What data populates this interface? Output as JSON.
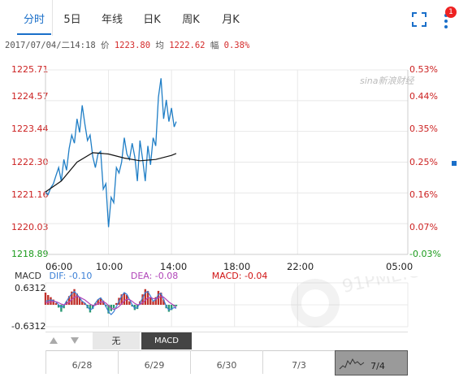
{
  "tabs": [
    {
      "label": "分时",
      "active": true
    },
    {
      "label": "5日"
    },
    {
      "label": "年线"
    },
    {
      "label": "日K"
    },
    {
      "label": "周K"
    },
    {
      "label": "月K"
    }
  ],
  "notification_count": "1",
  "info": {
    "datetime": "2017/07/04/二14:18",
    "price_label": "价",
    "price": "1223.80",
    "avg_label": "均",
    "avg": "1222.62",
    "change_label": "幅",
    "change": "0.38%"
  },
  "watermark": "sina新浪财经",
  "chart_data": {
    "type": "line",
    "y_ticks_price": [
      "1225.71",
      "1224.57",
      "1223.44",
      "1222.30",
      "1221.16",
      "1220.03",
      "1218.89"
    ],
    "y_ticks_pct": [
      "0.53%",
      "0.44%",
      "0.35%",
      "0.25%",
      "0.16%",
      "0.07%",
      "-0.03%"
    ],
    "x_ticks": [
      "06:00",
      "10:00",
      "14:00",
      "18:00",
      "22:00",
      "05:00"
    ],
    "ylim": [
      1218.89,
      1225.71
    ],
    "series": [
      {
        "name": "价",
        "color": "#1f7ec6",
        "x": [
          "06:00",
          "06:10",
          "06:20",
          "06:30",
          "06:40",
          "06:50",
          "07:00",
          "07:10",
          "07:20",
          "07:30",
          "07:40",
          "07:50",
          "08:00",
          "08:10",
          "08:20",
          "08:30",
          "08:40",
          "08:50",
          "09:00",
          "09:10",
          "09:20",
          "09:30",
          "09:40",
          "09:50",
          "10:00",
          "10:10",
          "10:20",
          "10:30",
          "10:40",
          "10:50",
          "11:00",
          "11:10",
          "11:20",
          "11:30",
          "11:40",
          "11:50",
          "12:00",
          "12:10",
          "12:20",
          "12:30",
          "12:40",
          "12:50",
          "13:00",
          "13:10",
          "13:20",
          "13:30",
          "13:40",
          "13:50",
          "14:00",
          "14:10",
          "14:18"
        ],
        "values": [
          1221.2,
          1221.1,
          1221.35,
          1221.5,
          1221.8,
          1222.1,
          1221.6,
          1222.4,
          1222.0,
          1222.8,
          1223.3,
          1223.0,
          1223.9,
          1223.4,
          1224.4,
          1223.7,
          1223.1,
          1223.3,
          1222.5,
          1222.1,
          1222.6,
          1222.7,
          1221.3,
          1221.5,
          1219.9,
          1221.0,
          1220.8,
          1222.1,
          1221.9,
          1222.3,
          1223.2,
          1222.6,
          1222.4,
          1223.0,
          1222.5,
          1221.6,
          1223.1,
          1222.4,
          1221.6,
          1222.9,
          1222.2,
          1223.2,
          1222.9,
          1224.7,
          1225.4,
          1223.9,
          1224.6,
          1223.8,
          1224.3,
          1223.6,
          1223.8
        ]
      },
      {
        "name": "均",
        "color": "#111111",
        "x": [
          "06:00",
          "07:00",
          "08:00",
          "09:00",
          "10:00",
          "11:00",
          "12:00",
          "13:00",
          "14:00",
          "14:18"
        ],
        "values": [
          1221.2,
          1221.6,
          1222.3,
          1222.65,
          1222.6,
          1222.45,
          1222.35,
          1222.4,
          1222.55,
          1222.62
        ]
      }
    ]
  },
  "macd": {
    "label": "MACD",
    "dif_label": "DIF: -0.10",
    "dea_label": "DEA: -0.08",
    "macd_label": "MACD: -0.04",
    "dif_color": "#3a7fd6",
    "dea_color": "#b044b8",
    "macd_color": "#d01414",
    "y_ticks": [
      "0.6312",
      "-0.6312"
    ],
    "ylim": [
      -0.6312,
      0.6312
    ],
    "bars": [
      0.35,
      0.28,
      0.22,
      0.15,
      0.05,
      -0.08,
      -0.2,
      -0.1,
      0.1,
      0.25,
      0.38,
      0.45,
      0.32,
      0.22,
      0.1,
      0.05,
      -0.1,
      -0.22,
      -0.12,
      0.05,
      0.15,
      0.2,
      0.12,
      -0.05,
      -0.25,
      -0.18,
      -0.1,
      0.05,
      0.2,
      0.3,
      0.35,
      0.28,
      0.1,
      -0.05,
      -0.15,
      -0.12,
      0.1,
      0.3,
      0.45,
      0.4,
      0.2,
      0.1,
      0.22,
      0.4,
      0.35,
      0.15,
      -0.1,
      -0.2,
      -0.15,
      -0.05,
      -0.04
    ],
    "dif": [
      0.1,
      0.12,
      0.14,
      0.12,
      0.08,
      0.0,
      -0.08,
      -0.02,
      0.1,
      0.22,
      0.32,
      0.38,
      0.3,
      0.2,
      0.1,
      0.05,
      -0.05,
      -0.15,
      -0.1,
      0.05,
      0.15,
      0.2,
      0.1,
      -0.05,
      -0.2,
      -0.28,
      -0.2,
      -0.05,
      0.1,
      0.25,
      0.35,
      0.3,
      0.15,
      0.0,
      -0.1,
      -0.08,
      0.05,
      0.2,
      0.35,
      0.38,
      0.25,
      0.1,
      0.15,
      0.3,
      0.33,
      0.15,
      -0.05,
      -0.15,
      -0.12,
      -0.08,
      -0.1
    ],
    "dea": [
      0.05,
      0.07,
      0.09,
      0.1,
      0.09,
      0.06,
      0.02,
      0.0,
      0.03,
      0.08,
      0.15,
      0.22,
      0.24,
      0.22,
      0.18,
      0.14,
      0.08,
      0.02,
      -0.02,
      -0.01,
      0.03,
      0.08,
      0.09,
      0.05,
      -0.02,
      -0.1,
      -0.13,
      -0.1,
      -0.05,
      0.03,
      0.12,
      0.16,
      0.15,
      0.1,
      0.04,
      0.0,
      0.01,
      0.06,
      0.13,
      0.2,
      0.21,
      0.18,
      0.17,
      0.2,
      0.24,
      0.22,
      0.15,
      0.08,
      0.03,
      -0.02,
      -0.08
    ]
  },
  "indicator_tabs": [
    {
      "label": "无"
    },
    {
      "label": "MACD",
      "active": true
    }
  ],
  "date_nav": [
    "6/28",
    "6/29",
    "6/30",
    "7/3",
    "7/4"
  ],
  "bottom_watermark": "91PME.COM"
}
